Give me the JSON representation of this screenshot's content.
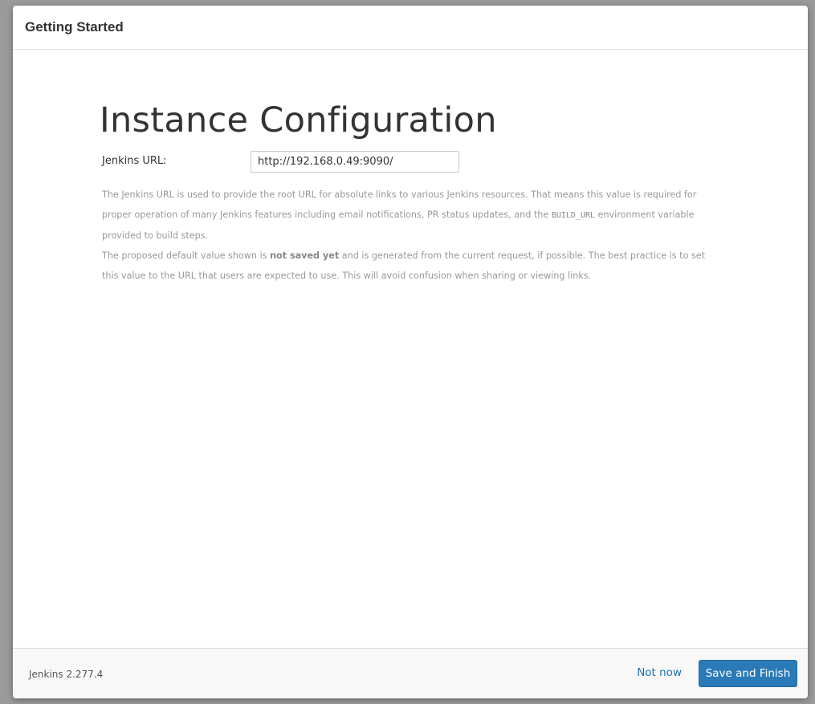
{
  "header": {
    "title": "Getting Started"
  },
  "main": {
    "heading": "Instance Configuration",
    "url_label": "Jenkins URL:",
    "url_value": "http://192.168.0.49:9090/",
    "help": {
      "p1_text_a": "The Jenkins URL is used to provide the root URL for absolute links to various Jenkins resources. That means this value is required for proper operation of many Jenkins features including email notifications, PR status updates, and the ",
      "p1_code": "BUILD_URL",
      "p1_text_b": " environment variable provided to build steps.",
      "p2_text_a": "The proposed default value shown is ",
      "p2_strong": "not saved yet",
      "p2_text_b": " and is generated from the current request, if possible. The best practice is to set this value to the URL that users are expected to use. This will avoid confusion when sharing or viewing links."
    }
  },
  "footer": {
    "version": "Jenkins 2.277.4",
    "not_now_label": "Not now",
    "save_label": "Save and Finish"
  },
  "colors": {
    "primary_button": "#2a7ab8",
    "link": "#1a73b5",
    "help_text": "#999999"
  }
}
